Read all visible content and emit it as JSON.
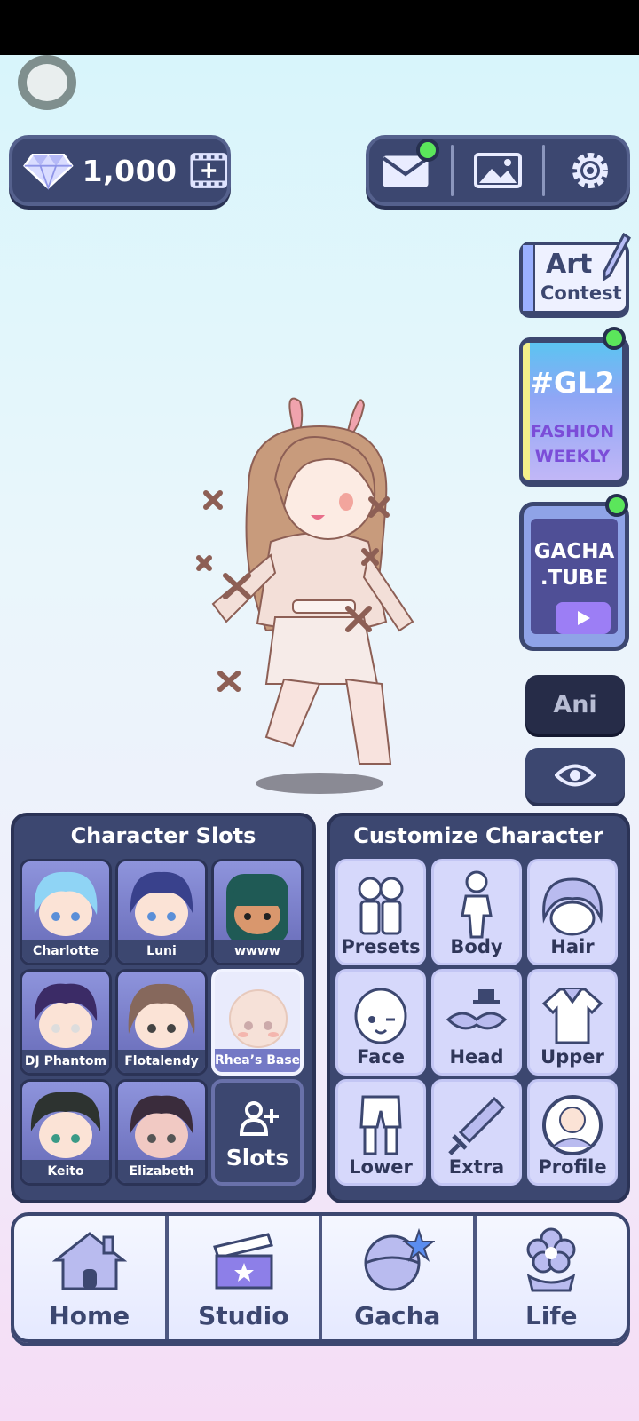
{
  "currency": {
    "amount": "1,000"
  },
  "side": {
    "art_line1": "Art",
    "art_line2": "Contest",
    "gl2_line1": "#GL2",
    "gl2_line2": "FASHION",
    "gl2_line3": "WEEKLY",
    "tube_line1": "GACHA",
    "tube_line2": ".TUBE",
    "ani_label": "Ani"
  },
  "slots_panel": {
    "title": "Character Slots",
    "slots": [
      {
        "name": "Charlotte",
        "hair": "#8fd4f5"
      },
      {
        "name": "Luni",
        "hair": "#39418c"
      },
      {
        "name": "wwww",
        "hair": "#1f5a55"
      },
      {
        "name": "DJ Phantom",
        "hair": "#3b2b66"
      },
      {
        "name": "Flotalendy",
        "hair": "#86685c"
      },
      {
        "name": "Rhea’s Base",
        "hair": "#f3ddd5"
      },
      {
        "name": "Keito",
        "hair": "#2d3330"
      },
      {
        "name": "Elizabeth",
        "hair": "#3a2c3c"
      }
    ],
    "add_label": "Slots"
  },
  "customize_panel": {
    "title": "Customize Character",
    "buttons": [
      "Presets",
      "Body",
      "Hair",
      "Face",
      "Head",
      "Upper",
      "Lower",
      "Extra",
      "Profile"
    ]
  },
  "nav": {
    "items": [
      "Home",
      "Studio",
      "Gacha",
      "Life"
    ]
  },
  "colors": {
    "panel": "#3c4770",
    "accent_green": "#5be65b",
    "button_bg": "#d6d8fb"
  }
}
